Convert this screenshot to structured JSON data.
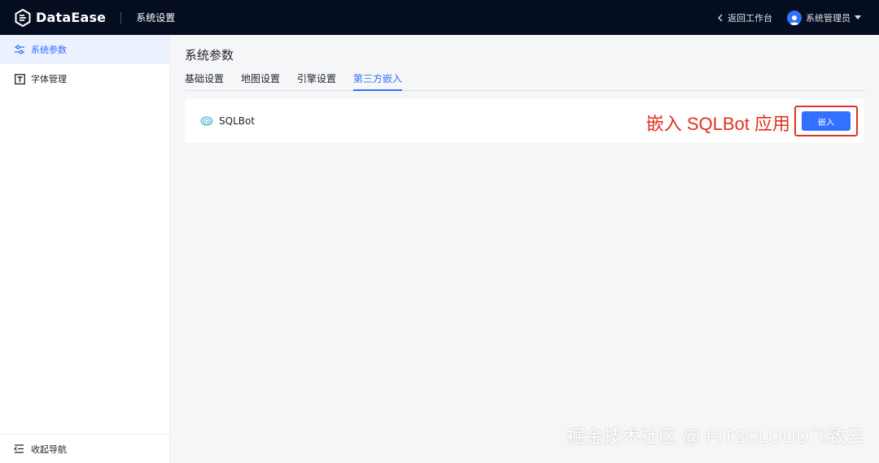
{
  "header": {
    "brand": "DataEase",
    "section_title": "系统设置",
    "back_label": "返回工作台",
    "user_name": "系统管理员"
  },
  "sidebar": {
    "items": [
      {
        "label": "系统参数",
        "icon": "sliders-icon",
        "active": true
      },
      {
        "label": "字体管理",
        "icon": "font-icon",
        "active": false
      }
    ],
    "collapse_label": "收起导航"
  },
  "main": {
    "page_title": "系统参数",
    "tabs": [
      {
        "label": "基础设置",
        "active": false
      },
      {
        "label": "地图设置",
        "active": false
      },
      {
        "label": "引擎设置",
        "active": false
      },
      {
        "label": "第三方嵌入",
        "active": true
      }
    ],
    "integration": {
      "name": "SQLBot",
      "icon": "sqlbot-icon",
      "button_label": "嵌入",
      "annotation": "嵌入 SQLBot 应用"
    }
  },
  "watermark": "掘金技术社区 @ FIT2CLOUD飞致云",
  "colors": {
    "topbar": "#050e21",
    "accent": "#3370ff",
    "annotation": "#e0321f"
  }
}
